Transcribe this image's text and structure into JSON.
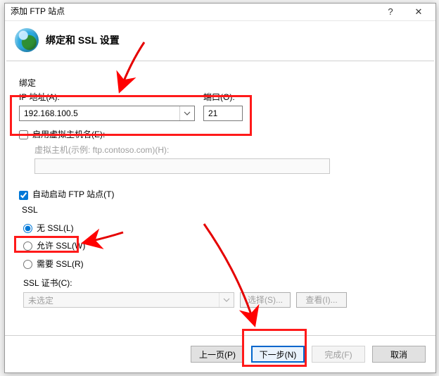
{
  "window": {
    "title": "添加 FTP 站点",
    "help_glyph": "?",
    "close_glyph": "✕"
  },
  "header": {
    "title": "绑定和 SSL 设置"
  },
  "binding": {
    "section_label": "绑定",
    "ip_label": "IP 地址(A):",
    "ip_value": "192.168.100.5",
    "port_label": "端口(O):",
    "port_value": "21"
  },
  "vhost": {
    "enable_label": "启用虚拟主机名(E):",
    "enable_checked": false,
    "host_label": "虚拟主机(示例: ftp.contoso.com)(H):",
    "host_value": ""
  },
  "autostart": {
    "label": "自动启动 FTP 站点(T)",
    "checked": true
  },
  "ssl": {
    "section_label": "SSL",
    "none_label": "无 SSL(L)",
    "allow_label": "允许 SSL(W)",
    "require_label": "需要 SSL(R)",
    "selected": "none",
    "cert_label": "SSL 证书(C):",
    "cert_value": "未选定",
    "select_btn": "选择(S)...",
    "view_btn": "查看(I)..."
  },
  "footer": {
    "prev": "上一页(P)",
    "next": "下一步(N)",
    "finish": "完成(F)",
    "cancel": "取消"
  }
}
